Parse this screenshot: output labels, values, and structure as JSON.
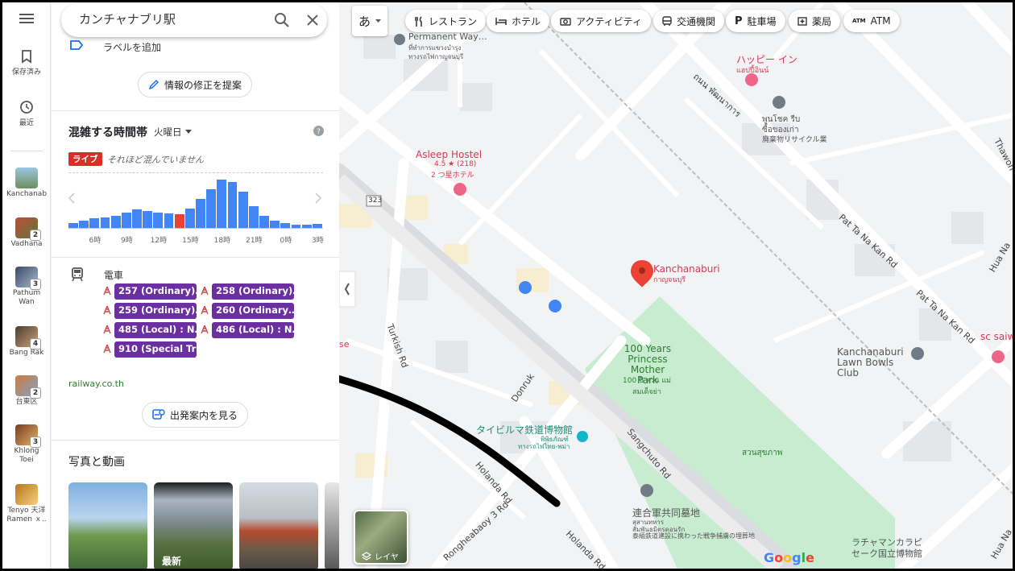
{
  "search": {
    "value": "カンチャナブリ駅"
  },
  "rail": {
    "saved_label": "保存済み",
    "recent_label": "最近",
    "recents": [
      {
        "label": "Kanchanab",
        "badge": ""
      },
      {
        "label": "Vadhana",
        "badge": "2"
      },
      {
        "label": "Pathum Wan",
        "badge": "3"
      },
      {
        "label": "Bang Rak",
        "badge": "4"
      },
      {
        "label": "台東区",
        "badge": "2"
      },
      {
        "label": "Khlong Toei",
        "badge": "3"
      },
      {
        "label": "Tenyo 天洋 Ramen ｘ..",
        "badge": ""
      }
    ]
  },
  "panel": {
    "add_label": "ラベルを追加",
    "suggest_edit": "情報の修正を提案",
    "popular_times": {
      "title": "混雑する時間帯",
      "day": "火曜日",
      "live_badge": "ライブ",
      "live_text": "それほど混んでいません",
      "hours": [
        "6時",
        "9時",
        "12時",
        "15時",
        "18時",
        "21時",
        "0時",
        "3時"
      ],
      "levels": [
        0.1,
        0.15,
        0.2,
        0.22,
        0.25,
        0.32,
        0.38,
        0.35,
        0.32,
        0.3,
        0.28,
        0.4,
        0.6,
        0.8,
        1.0,
        0.95,
        0.75,
        0.45,
        0.25,
        0.15,
        0.1,
        0.07,
        0.06,
        0.08
      ],
      "live_index": 10,
      "colors": {
        "bar": "#4285f4",
        "live": "#ea4335"
      }
    },
    "transit": {
      "type": "電車",
      "routes": [
        "257 (Ordinary)…",
        "258 (Ordinary)…",
        "259 (Ordinary)…",
        "260 (Ordinary…",
        "485 (Local) : N…",
        "486 (Local) : N…",
        "910 (Special Tr…"
      ],
      "link": "railway.co.th",
      "departures_btn": "出発案内を見る",
      "route_color": "#6b2fa0"
    },
    "photos": {
      "title": "写真と動画",
      "items": [
        "",
        "最新",
        "",
        ""
      ]
    }
  },
  "map": {
    "lang_btn": "あ",
    "chips": [
      "レストラン",
      "ホテル",
      "アクティビティ",
      "交通機関",
      "駐車場",
      "薬局",
      "ATM"
    ],
    "labels": {
      "permanent_way": "Permanent Way…",
      "permanent_way_th": "ที่ทำการแขวงบำรุง",
      "permanent_way_th2": "ทางรถไฟกาญจนบุรี",
      "happy_inn": "ハッピー イン",
      "happy_inn_th": "แฮปปี้อินน์",
      "phun_chok": "พูนโชค รีบ",
      "phun_chok2": "ซื้อของเก่า",
      "phun_chok3": "廃棄物リサイクル業",
      "asleep": "Asleep Hostel",
      "asleep_rating": "4.5 ★ (218)",
      "asleep_type": "2 つ星ホテル",
      "kanchanaburi": "Kanchanaburi",
      "kanchanaburi_th": "กาญจนบุรี",
      "park": "100 Years Princess Mother Park",
      "park_th": "100 ปี สวน แม่สมเด็จย่า",
      "lawn_bowls": "Kanchanaburi Lawn Bowls Club",
      "museum": "タイビルマ鉄道博物館",
      "museum_th": "พิพิธภัณฑ์",
      "museum_th2": "ทางรถไฟไทย-พม่า",
      "cemetery": "連合軍共同墓地",
      "cemetery_th": "สุสานทหาร",
      "cemetery_th2": "สัมพันธมิตรดอนรัก",
      "cemetery_jp": "泰緬鉄道建設に携わった戦争捕虜の埋葬地",
      "suan": "สวนสุขภาพ",
      "lacha": "ラチャマンカラピ",
      "lacha2": "セーク国立博物館",
      "sc_saiwai": "sc saiwi",
      "road_pat1": "Pat Ta Na Kan Rd",
      "road_pat2": "Pat Ta Na Kan Rd",
      "road_thanon": "ถนน พัฒนาการ",
      "road_thawon": "Thawon Wi",
      "road_hua": "Hua Na",
      "road_hua2": "Hua Na",
      "road_turkish": "Turkish Rd",
      "road_donruk": "Donruk",
      "road_sangchuto": "Sangchuto Rd",
      "road_holanda": "Holanda Rd",
      "road_holanda2": "Holanda Rd",
      "road_rongheabaoy": "Rongheabaoy 3 Rd",
      "route_323": "323",
      "layer_btn": "レイヤ",
      "google": "Google",
      "partial": "se",
      "partial2": "ホ"
    }
  }
}
